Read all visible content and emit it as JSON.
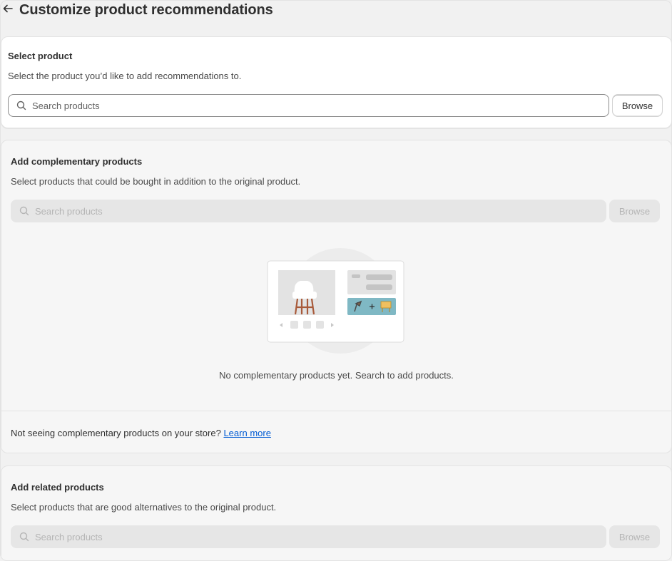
{
  "page": {
    "title": "Customize product recommendations"
  },
  "select_product": {
    "title": "Select product",
    "description": "Select the product you’d like to add recommendations to.",
    "search_placeholder": "Search products",
    "browse_label": "Browse"
  },
  "complementary": {
    "title": "Add complementary products",
    "description": "Select products that could be bought in addition to the original product.",
    "search_placeholder": "Search products",
    "browse_label": "Browse",
    "empty_text": "No complementary products yet. Search to add products.",
    "footer_text": "Not seeing complementary products on your store?",
    "learn_more": "Learn more"
  },
  "related": {
    "title": "Add related products",
    "description": "Select products that are good alternatives to the original product.",
    "search_placeholder": "Search products",
    "browse_label": "Browse"
  },
  "icons": [
    "arrow-left-icon",
    "search-icon",
    "chair-icon",
    "lamp-icon",
    "plus-icon",
    "cabinet-icon"
  ],
  "colors": {
    "link": "#005bd3",
    "teal_accent": "#7fb8c4",
    "chair_legs": "#a85a3a",
    "cabinet": "#f0c060"
  }
}
